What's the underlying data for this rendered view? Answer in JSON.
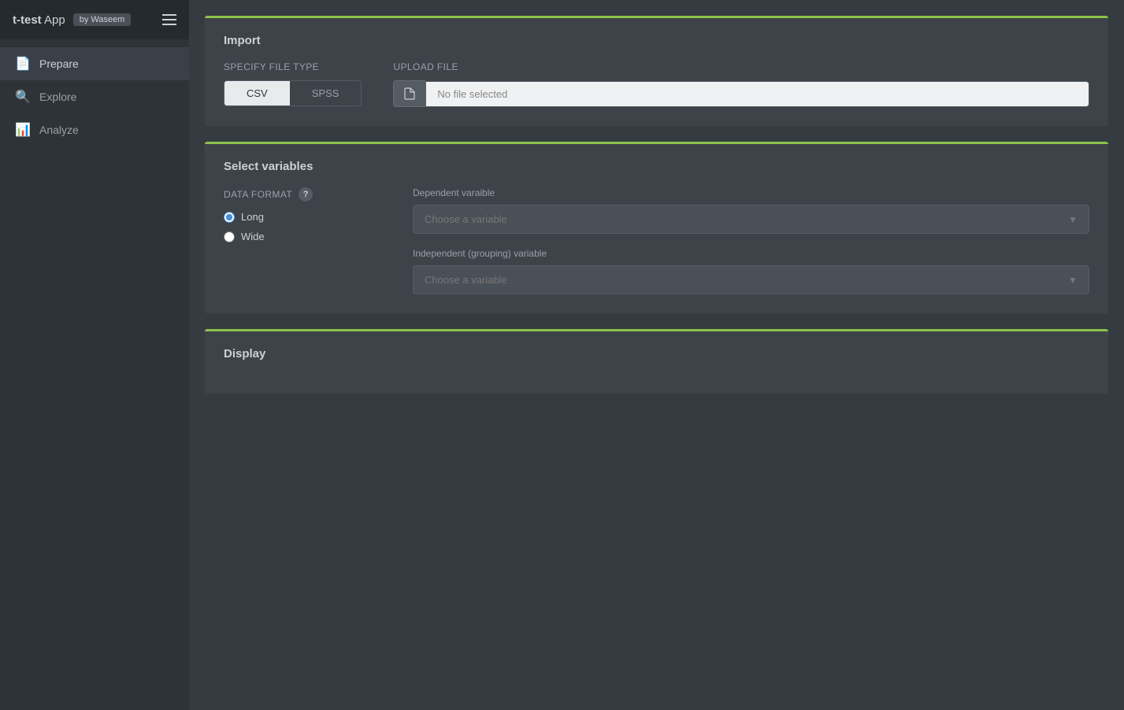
{
  "app": {
    "title_bold": "t-test",
    "title_rest": " App",
    "by_label": "by Waseem"
  },
  "sidebar": {
    "nav_items": [
      {
        "id": "prepare",
        "label": "Prepare",
        "icon": "📄",
        "active": true
      },
      {
        "id": "explore",
        "label": "Explore",
        "icon": "🔍",
        "active": false
      },
      {
        "id": "analyze",
        "label": "Analyze",
        "icon": "📊",
        "active": false
      }
    ]
  },
  "import_section": {
    "title": "Import",
    "file_type_label": "Specify file type",
    "csv_label": "CSV",
    "spss_label": "SPSS",
    "upload_label": "Upload file",
    "no_file_text": "No file selected"
  },
  "variables_section": {
    "title": "Select variables",
    "data_format_label": "Data format",
    "format_options": [
      {
        "value": "long",
        "label": "Long",
        "checked": true
      },
      {
        "value": "wide",
        "label": "Wide",
        "checked": false
      }
    ],
    "dependent_label": "Dependent varaible",
    "dependent_placeholder": "Choose a variable",
    "independent_label": "Independent (grouping) variable",
    "independent_placeholder": "Choose a variable"
  },
  "display_section": {
    "title": "Display"
  }
}
